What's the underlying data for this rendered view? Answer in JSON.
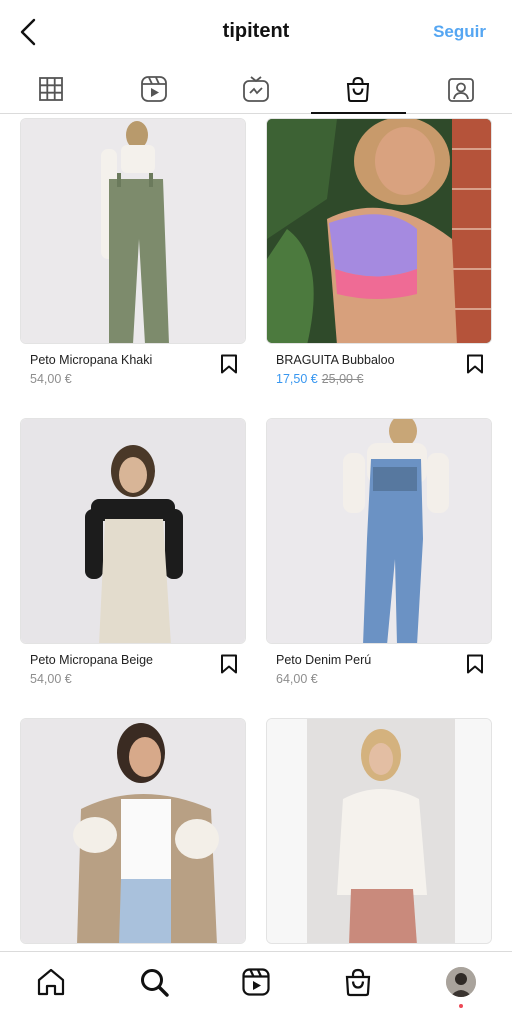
{
  "header": {
    "title": "tipitent",
    "follow_label": "Seguir",
    "back_icon": "chevron-left-icon"
  },
  "tabs": [
    {
      "name": "grid-icon",
      "active": false
    },
    {
      "name": "reels-icon",
      "active": false
    },
    {
      "name": "igtv-icon",
      "active": false
    },
    {
      "name": "shop-bag-icon",
      "active": true
    },
    {
      "name": "tagged-icon",
      "active": false
    }
  ],
  "products": [
    {
      "name": "Peto Micropana Khaki",
      "price": "54,00 €"
    },
    {
      "name": "BRAGUITA Bubbaloo",
      "price": "17,50 €",
      "old_price": "25,00 €"
    },
    {
      "name": "Peto Micropana Beige",
      "price": "54,00 €"
    },
    {
      "name": "Peto Denim Perú",
      "price": "64,00 €"
    },
    {
      "name": "",
      "price": ""
    },
    {
      "name": "",
      "price": ""
    }
  ],
  "bottom_nav": [
    {
      "name": "home-icon"
    },
    {
      "name": "search-icon"
    },
    {
      "name": "reels-icon"
    },
    {
      "name": "shop-icon"
    },
    {
      "name": "profile-avatar"
    }
  ],
  "colors": {
    "accent": "#3897f0",
    "notification": "#ed4956"
  }
}
